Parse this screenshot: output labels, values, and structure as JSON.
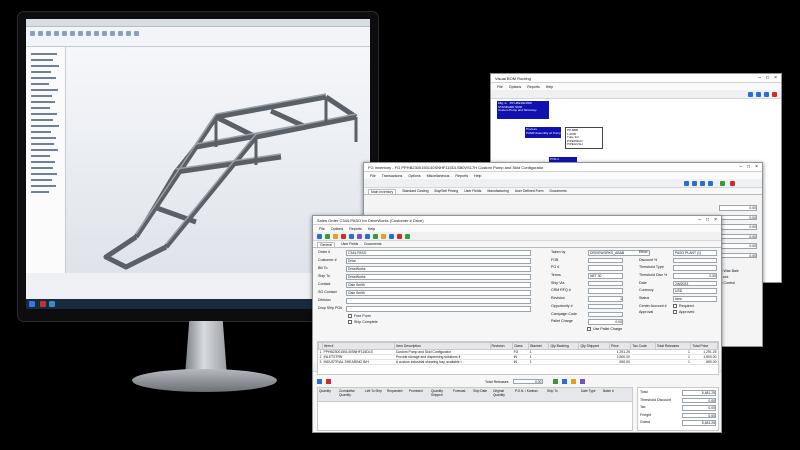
{
  "visual_bom": {
    "title": "Visual BOM Routing",
    "menu": [
      "File",
      "Options",
      "Reports",
      "Help"
    ],
    "nodes": [
      {
        "text": "Mfg. A    PP:HB2300150F\nSTANDARD SKID\nCustom Pump and Skid Assy"
      },
      {
        "text": "Process\nPUMP Assembly w/ Pump"
      },
      {
        "text": "PP-BBB\n1.0000\nTube 3/4\nPIPEWELD\nPIPEGUSH"
      },
      {
        "text": "PVR-3\n1.0000"
      },
      {
        "text": "Subframe"
      }
    ]
  },
  "inventory": {
    "title": "FG Inventory - FG PPHB2300150140SNHF115DLSB0VS17H Custom Pump and Skid Configurator",
    "menu": [
      "File",
      "Transactions",
      "Options",
      "Miscellaneous",
      "Reports",
      "Help"
    ],
    "tabs": [
      "Main Inventory",
      "Standard Costing",
      "Buy/Sell Pricing",
      "User Fields",
      "Manufacturing",
      "User Defined Form",
      "Documents"
    ],
    "right_values": [
      "0.00",
      "0.00",
      "0.00",
      "0.00",
      "0.00",
      "0.00"
    ],
    "side_notes": [
      "uffix Was Bale",
      "idt Lock",
      "uffix Control"
    ]
  },
  "sales_order": {
    "title": "Sales Order C344-PASO for DriveWorks (Customer # Drive)",
    "menu": [
      "File",
      "Options",
      "Reports",
      "Help"
    ],
    "tabs": [
      "General",
      "User Fields",
      "Documents"
    ],
    "left_fields": [
      {
        "label": "Order #",
        "value": "C344-PASO"
      },
      {
        "label": "Customer #",
        "value": "Drive"
      },
      {
        "label": "Bill To",
        "value": "DriveWorks"
      },
      {
        "label": "Ship To",
        "value": "DriveWorks"
      },
      {
        "label": "Contact",
        "value": "Gain Smith"
      },
      {
        "label": "SO Contact",
        "value": "Gain Smith"
      },
      {
        "label": "Division",
        "value": ""
      },
      {
        "label": "Drop Ship PO#",
        "value": ""
      }
    ],
    "left_checks": [
      "Free Form",
      "Ship Complete"
    ],
    "mid_fields": [
      {
        "label": "Taken by",
        "value": "DRIVEWORKS_ABAB"
      },
      {
        "label": "FOB",
        "value": ""
      },
      {
        "label": "PO #",
        "value": ""
      },
      {
        "label": "Terms",
        "value": "NET 30"
      },
      {
        "label": "Ship Via",
        "value": ""
      },
      {
        "label": "CRM RFQ #",
        "value": ""
      },
      {
        "label": "Revision",
        "value": "1"
      },
      {
        "label": "Opportunity #",
        "value": ""
      },
      {
        "label": "Campaign Code",
        "value": ""
      },
      {
        "label": "Pallet Charge",
        "value": "0.00"
      }
    ],
    "mid_check": "Use Pallet Charge",
    "right_fields": [
      {
        "label": "Effort",
        "value": "PASO PLANT (1)"
      },
      {
        "label": "Discount %",
        "value": ""
      },
      {
        "label": "Threshold Type",
        "value": ""
      },
      {
        "label": "Threshold Disc %",
        "value": "0.00"
      },
      {
        "label": "Date",
        "value": "2/6/2023"
      },
      {
        "label": "Currency",
        "value": "USD"
      },
      {
        "label": "Status",
        "value": "New"
      },
      {
        "label": "Center Account #",
        "value": ""
      },
      {
        "label": "Approval",
        "value": ""
      }
    ],
    "right_checks": [
      "Required",
      "Approved"
    ],
    "filter_label": "Filter Customer's Item",
    "table_headers": [
      "Item #",
      "Item Description",
      "Revision",
      "Class",
      "Blanket",
      "Qty Backing",
      "Qty Shipped",
      "Price",
      "Tax Code",
      "Total Releases",
      "Total Price"
    ],
    "rows": [
      [
        "1",
        "PPHB2300150140SNHF115DLS",
        "Custom Pump and Skid Configurator",
        "",
        "FG",
        "1",
        "",
        "",
        "1,291.25",
        "",
        "1",
        "1,291.25"
      ],
      [
        "2",
        "INLETSTRN",
        "Provide storage and dispensing solutions fi",
        "",
        "IN",
        "1",
        "",
        "",
        "1,500.00",
        "",
        "1",
        "1,500.00"
      ],
      [
        "3",
        "INDUSTRIAL SHEARING B/H",
        "A custom industrial shearing bay, available i",
        "",
        "IN",
        "1",
        "",
        "",
        "690.00",
        "",
        "1",
        "690.00"
      ]
    ],
    "total_releases_label": "Total Releases",
    "total_releases_value": "0.00",
    "release_headers": [
      "Quantity",
      "Cumulative Quantity",
      "Left To Ship",
      "Requested",
      "Promised",
      "Quantity Shipped",
      "Forecast",
      "Ship Date",
      "Original Quantity",
      "P.O.N. / Kanban",
      "Ship To",
      "Date Type",
      "Batch #"
    ],
    "summary": [
      {
        "label": "Total",
        "value": "5,481.25"
      },
      {
        "label": "Threshold Discount",
        "value": "0.00"
      },
      {
        "label": "Tax",
        "value": "0.00"
      },
      {
        "label": "Freight",
        "value": "0.00"
      },
      {
        "label": "Grand",
        "value": "5,481.25"
      }
    ]
  }
}
